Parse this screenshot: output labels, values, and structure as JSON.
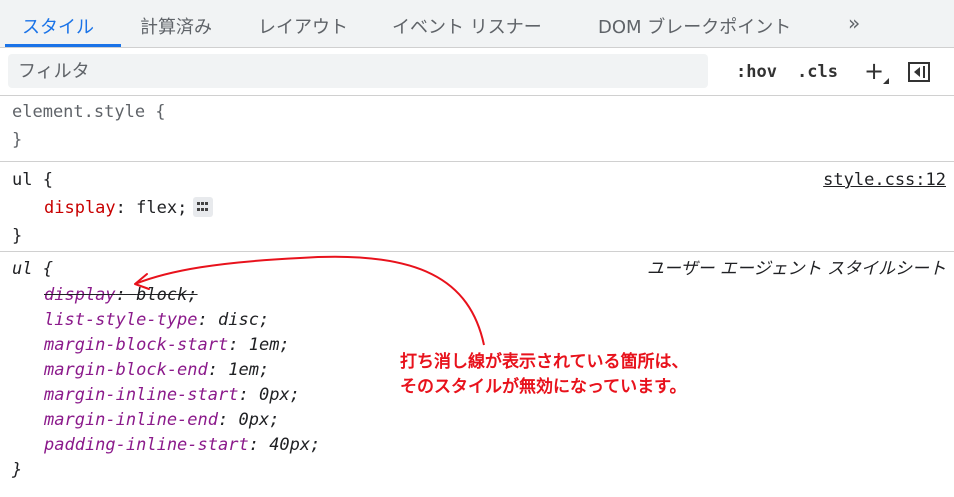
{
  "tabs": [
    {
      "label": "スタイル",
      "active": true
    },
    {
      "label": "計算済み",
      "active": false
    },
    {
      "label": "レイアウト",
      "active": false
    },
    {
      "label": "イベント リスナー",
      "active": false
    },
    {
      "label": "DOM ブレークポイント",
      "active": false
    }
  ],
  "more_tabs": "»",
  "filter": {
    "placeholder": "フィルタ",
    "value": ""
  },
  "toolbar": {
    "hov": ":hov",
    "cls": ".cls",
    "add": "+",
    "toggle_icon": "toggle-sidebar-icon"
  },
  "rules": {
    "element_style": {
      "selector": "element.style {",
      "close": "}"
    },
    "ul_author": {
      "selector": "ul {",
      "source": "style.css:12",
      "prop": "display",
      "value": "flex;",
      "close": "}"
    },
    "ul_ua": {
      "selector": "ul {",
      "source": "ユーザー エージェント スタイルシート",
      "declarations": [
        {
          "prop": "display",
          "value": "block;",
          "struck": true
        },
        {
          "prop": "list-style-type",
          "value": "disc;",
          "struck": false
        },
        {
          "prop": "margin-block-start",
          "value": "1em;",
          "struck": false
        },
        {
          "prop": "margin-block-end",
          "value": "1em;",
          "struck": false
        },
        {
          "prop": "margin-inline-start",
          "value": "0px;",
          "struck": false
        },
        {
          "prop": "margin-inline-end",
          "value": "0px;",
          "struck": false
        },
        {
          "prop": "padding-inline-start",
          "value": "40px;",
          "struck": false
        }
      ],
      "close": "}"
    }
  },
  "annotation": {
    "line1": "打ち消し線が表示されている箇所は、",
    "line2": "そのスタイルが無効になっています。",
    "color": "#e8121c"
  },
  "colors": {
    "accent": "#1a73e8",
    "property": "#c80000"
  }
}
